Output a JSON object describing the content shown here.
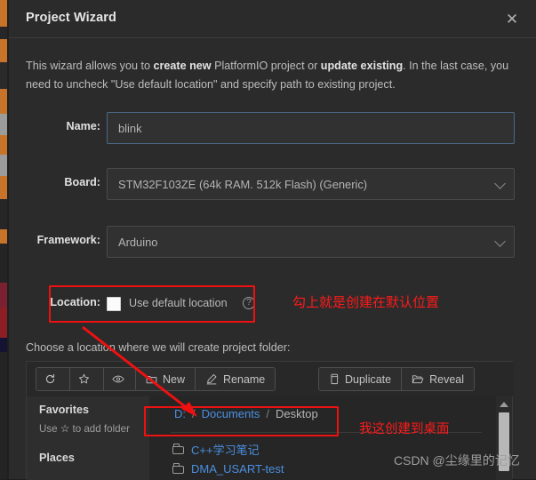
{
  "window": {
    "title": "Project Wizard",
    "close_label": "✕"
  },
  "intro": {
    "part1": "This wizard allows you to ",
    "bold1": "create new",
    "part2": " PlatformIO project or ",
    "bold2": "update existing",
    "part3": ". In the last case, you need to uncheck \"Use default location\" and specify path to existing project."
  },
  "form": {
    "name": {
      "label": "Name:",
      "value": "blink",
      "placeholder": "blink"
    },
    "board": {
      "label": "Board:",
      "value": "STM32F103ZE (64k RAM. 512k Flash) (Generic)"
    },
    "framework": {
      "label": "Framework:",
      "value": "Arduino"
    },
    "location": {
      "label": "Location:",
      "checkbox_text": "Use default location",
      "checked": false,
      "help_glyph": "?"
    }
  },
  "choose_label": "Choose a location where we will create project folder:",
  "toolbar": {
    "refresh": {
      "label": "",
      "icon": "refresh-icon"
    },
    "favorite": {
      "label": "",
      "icon": "star-icon"
    },
    "preview": {
      "label": "",
      "icon": "eye-icon"
    },
    "new": {
      "label": "New",
      "icon": "new-folder-icon"
    },
    "rename": {
      "label": "Rename",
      "icon": "pencil-icon"
    },
    "duplicate": {
      "label": "Duplicate",
      "icon": "duplicate-icon"
    },
    "reveal": {
      "label": "Reveal",
      "icon": "open-folder-icon"
    }
  },
  "sidebar": {
    "favorites_title": "Favorites",
    "favorites_hint_pre": "Use ",
    "favorites_hint_star": "☆",
    "favorites_hint_post": " to add folder",
    "places_title": "Places"
  },
  "breadcrumb": {
    "segments": [
      {
        "label": "D:",
        "current": false
      },
      {
        "label": "Documents",
        "current": false
      },
      {
        "label": "Desktop",
        "current": true
      }
    ],
    "separator": "/"
  },
  "files": [
    {
      "name": "C++学习笔记",
      "type": "folder"
    },
    {
      "name": "DMA_USART-test",
      "type": "folder"
    }
  ],
  "annotations": {
    "location_note": "勾上就是创建在默认位置",
    "desktop_note": "我这创建到桌面"
  },
  "watermark": "CSDN @尘缘里的记忆",
  "colors": {
    "dialog_bg": "#2b2b2b",
    "accent_blue": "#4a8fe0",
    "annotation_red": "#ff1a1a",
    "field_border_focus": "#4a6a86"
  }
}
